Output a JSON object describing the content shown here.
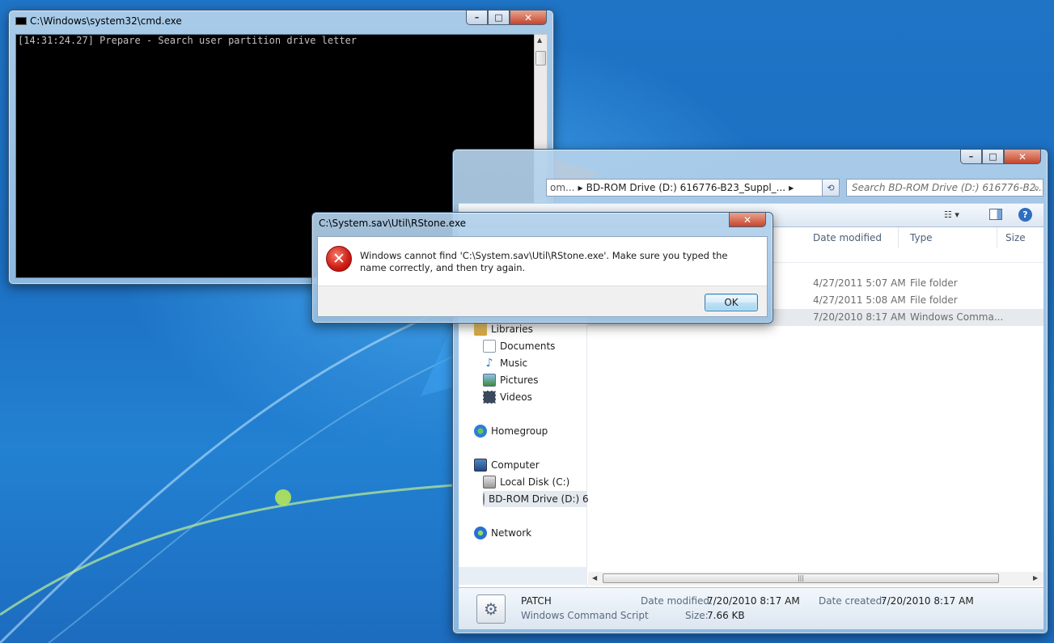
{
  "cmd_window": {
    "title": "C:\\Windows\\system32\\cmd.exe",
    "console_line": "[14:31:24.27] Prepare - Search user partition drive letter",
    "minimize": "–",
    "maximize": "□",
    "close": "✕"
  },
  "explorer": {
    "address_prefix": "om...",
    "address_segment": "BD-ROM Drive (D:) 616776-B23_Suppl_...",
    "search_placeholder": "Search BD-ROM Drive (D:) 616776-B2...",
    "columns": [
      "Date modified",
      "Type",
      "Size"
    ],
    "rows": [
      {
        "date": "4/27/2011 5:07 AM",
        "type": "File folder"
      },
      {
        "date": "4/27/2011 5:08 AM",
        "type": "File folder"
      },
      {
        "date": "7/20/2010 8:17 AM",
        "type": "Windows Comma..."
      }
    ],
    "nav": {
      "libraries": "Libraries",
      "documents": "Documents",
      "music": "Music",
      "pictures": "Pictures",
      "videos": "Videos",
      "homegroup": "Homegroup",
      "computer": "Computer",
      "local_disk": "Local Disk (C:)",
      "bdrom": "BD-ROM Drive (D:) 6",
      "network": "Network"
    },
    "details": {
      "name": "PATCH",
      "filetype": "Windows Command Script",
      "date_modified_label": "Date modified:",
      "date_modified": "7/20/2010 8:17 AM",
      "date_created_label": "Date created:",
      "date_created": "7/20/2010 8:17 AM",
      "size_label": "Size:",
      "size": "7.66 KB"
    }
  },
  "dialog": {
    "title": "C:\\System.sav\\Util\\RStone.exe",
    "message": "Windows cannot find 'C:\\System.sav\\Util\\RStone.exe'. Make sure you typed the name correctly, and then try again.",
    "ok_label": "OK",
    "close": "✕"
  }
}
